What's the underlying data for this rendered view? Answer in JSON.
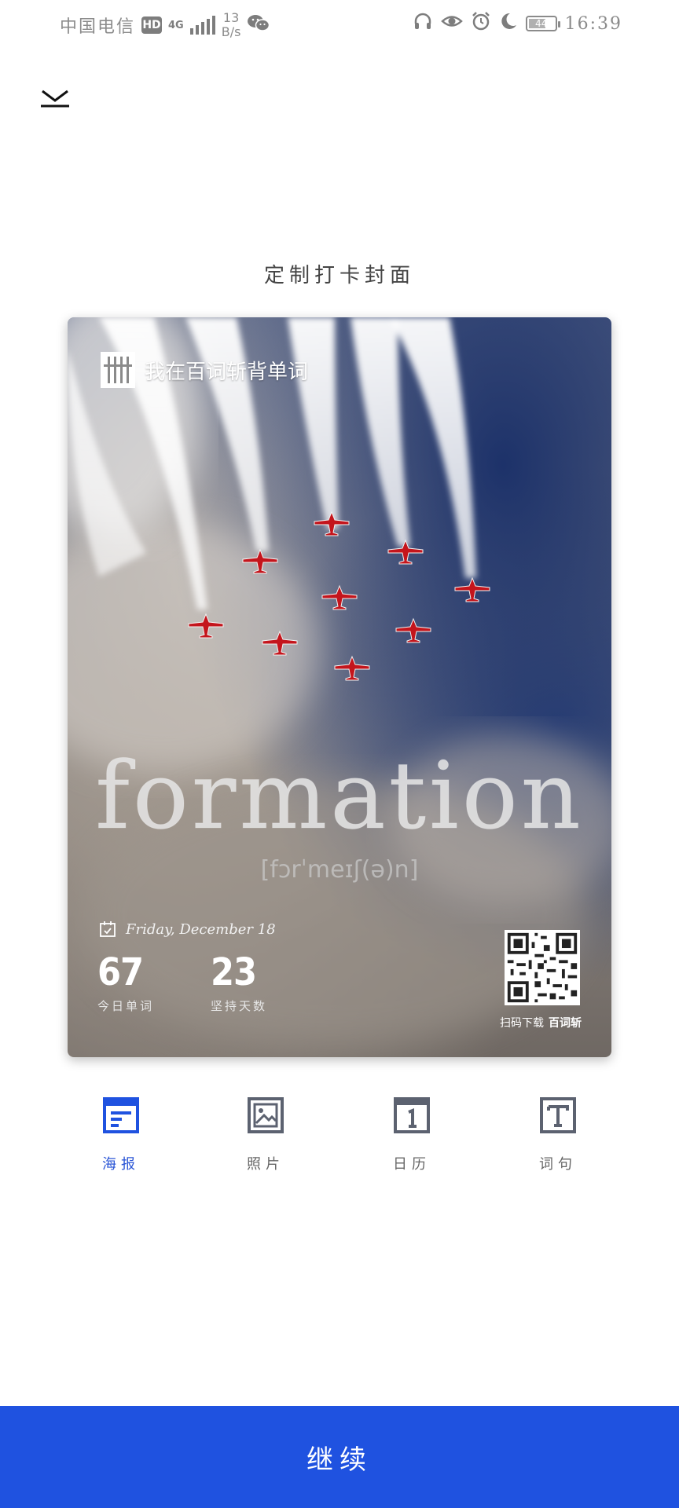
{
  "status_bar": {
    "carrier": "中国电信",
    "hd_badge": "HD",
    "network_type": "4G",
    "net_speed_value": "13",
    "net_speed_unit": "B/s",
    "battery_level": "44",
    "time": "16:39",
    "icons": [
      "wechat-icon",
      "headphones-icon",
      "eye-icon",
      "alarm-icon",
      "moon-icon",
      "battery-icon"
    ]
  },
  "header": {
    "collapse_icon": "collapse-down-icon",
    "title": "定制打卡封面"
  },
  "poster": {
    "brand_text": "我在百词斩背单词",
    "word": "formation",
    "phonetic": "[fɔrˈmeɪʃ(ə)n]",
    "date": "Friday, December 18",
    "stats": [
      {
        "value": "67",
        "label": "今日单词"
      },
      {
        "value": "23",
        "label": "坚持天数"
      }
    ],
    "qr_caption_prefix": "扫码下载",
    "qr_caption_app": "百词斩"
  },
  "tabs": [
    {
      "label": "海报",
      "icon": "poster-icon",
      "active": true
    },
    {
      "label": "照片",
      "icon": "photo-icon",
      "active": false
    },
    {
      "label": "日历",
      "icon": "calendar-icon",
      "active": false
    },
    {
      "label": "词句",
      "icon": "text-icon",
      "active": false
    }
  ],
  "colors": {
    "accent": "#1f52e0",
    "tab_inactive": "#5c6270"
  },
  "continue_button": {
    "label": "继续"
  }
}
